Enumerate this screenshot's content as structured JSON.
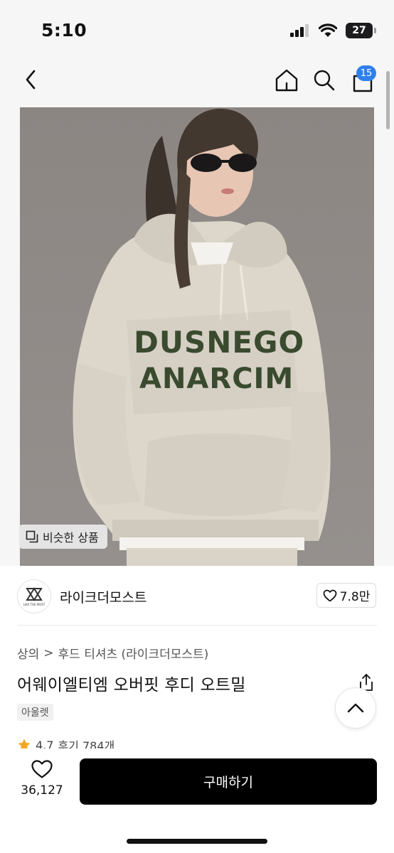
{
  "status_bar": {
    "time": "5:10",
    "battery_level": "27"
  },
  "nav": {
    "cart_count": "15"
  },
  "product_image": {
    "print_line1": "DUSNEGO",
    "print_line2": "ANARCIM",
    "similar_label": "비슷한 상품"
  },
  "brand": {
    "name": "라이크더모스트",
    "logo_text": "LIKE THE MOST",
    "likes": "7.8만"
  },
  "breadcrumb": {
    "root": "상의",
    "separator": ">",
    "category": "후드 티셔츠 (라이크더모스트)"
  },
  "product": {
    "title": "어웨이엘티엠 오버핏 후디 오트밀",
    "badge": "아울렛",
    "rating": "4.7",
    "reviews": "후기 784개"
  },
  "bottom_bar": {
    "wish_count": "36,127",
    "buy_label": "구매하기"
  },
  "colors": {
    "badge_blue": "#2f80ed",
    "buy_button": "#000000",
    "star": "#f5a623",
    "print_green": "#3a4a2f",
    "hoodie": "#dcd6cb"
  }
}
